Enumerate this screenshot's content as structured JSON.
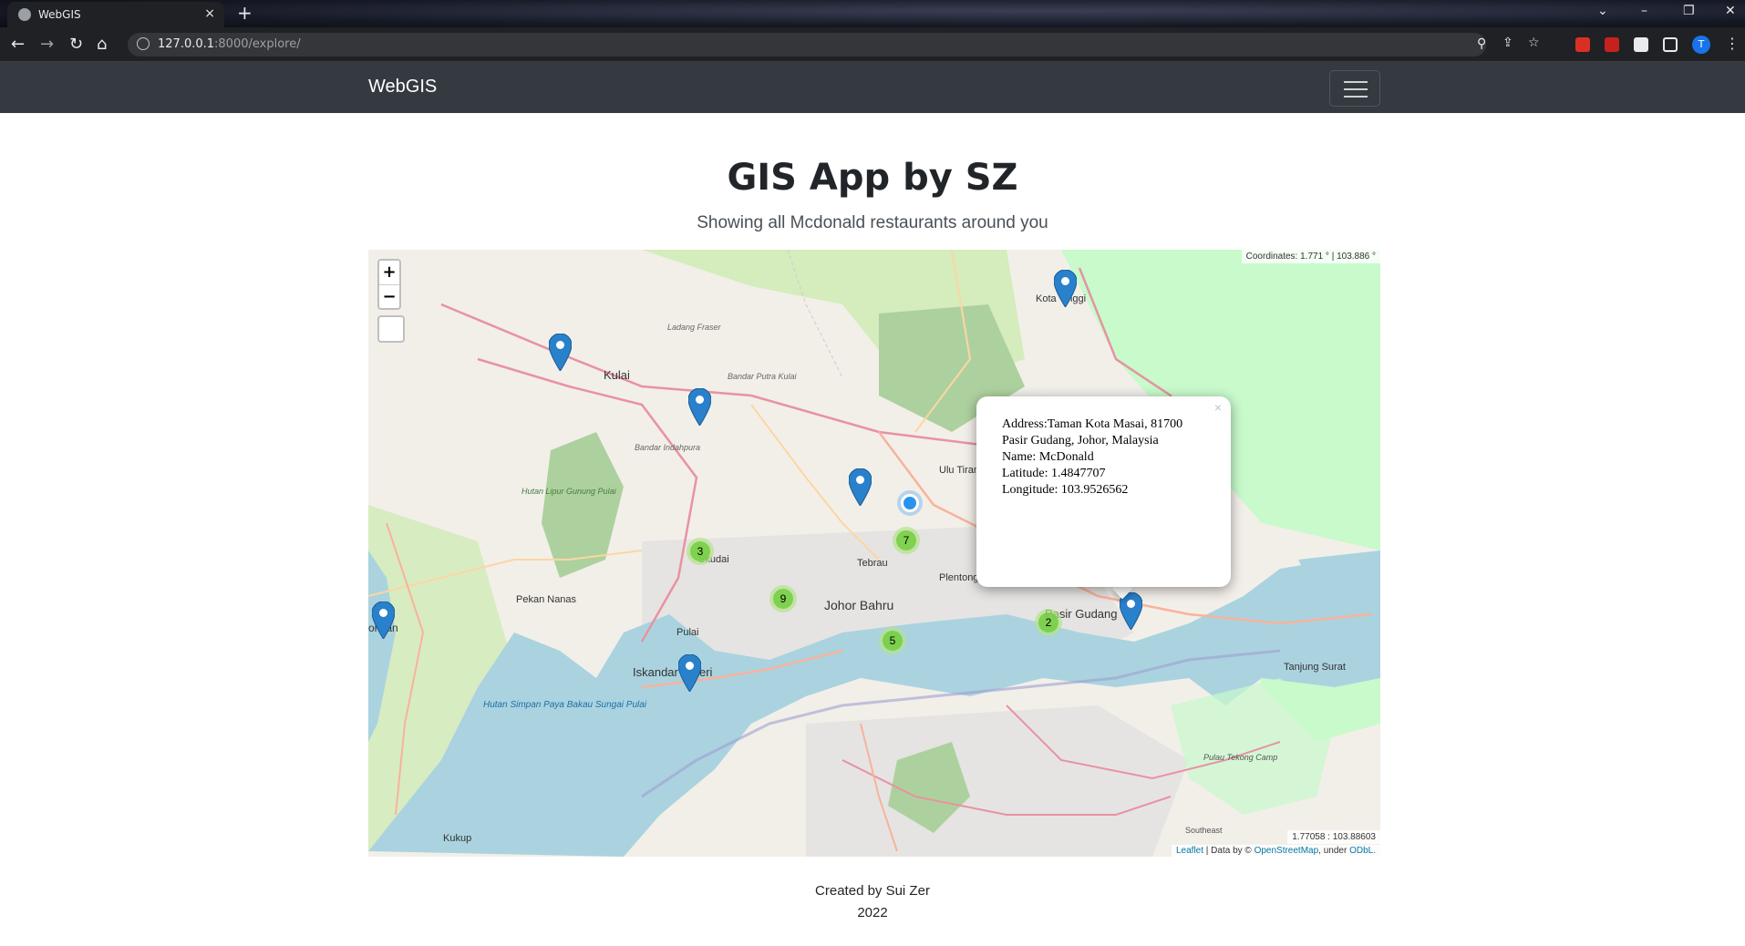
{
  "browser": {
    "tab_title": "WebGIS",
    "tab_close": "×",
    "new_tab": "+",
    "url_host": "127.0.0.1",
    "url_path": ":8000/explore/",
    "profile_initial": "T"
  },
  "navbar": {
    "brand": "WebGIS"
  },
  "header": {
    "title": "GIS App by SZ",
    "subtitle": "Showing all Mcdonald restaurants around you"
  },
  "map": {
    "zoom_in": "+",
    "zoom_out": "−",
    "coordinates": "Coordinates: 1.771 ° | 103.886 °",
    "mouse_position": "1.77058 : 103.88603",
    "attribution": {
      "leaflet": "Leaflet",
      "data_by": " | Data by © ",
      "osm": "OpenStreetMap",
      "under": ", under ",
      "odbl": "ODbL."
    },
    "clusters": [
      "3",
      "7",
      "9",
      "5",
      "2"
    ],
    "place_labels": {
      "kulai": "Kulai",
      "johor_bahru": "Johor Bahru",
      "iskandar_puteri": "Iskandar Puteri",
      "pasir_gudang": "Pasir Gudang",
      "skudai": "Skudai",
      "tebrau": "Tebrau",
      "plentong": "Plentong",
      "kota_tinggi": "Kota Tinggi",
      "ulu_tiram": "Ulu Tiram",
      "pekan_nanas": "Pekan Nanas",
      "tanjung_surat": "Tanjung Surat",
      "kukup": "Kukup",
      "pulai": "Pulai",
      "pontian": "ontian",
      "ladang_fraser": "Ladang Fraser",
      "bandar_putra_kulai": "Bandar Putra Kulai",
      "hutan_lipur": "Hutan Lipur Gunung Pulai",
      "hutan_simpan": "Hutan Simpan Paya Bakau Sungai Pulai",
      "pulau_tekong": "Pulau Tekong Camp",
      "southeast": "Southeast",
      "bandar_indahpura": "Bandar Indahpura"
    },
    "popup": {
      "close": "×",
      "address": "Address:Taman Kota Masai, 81700 Pasir Gudang, Johor, Malaysia",
      "name": "Name: McDonald",
      "latitude": "Latitude: 1.4847707",
      "longitude": "Longitude: 103.9526562"
    }
  },
  "footer": {
    "line1": "Created by Sui Zer",
    "line2": "2022"
  },
  "colors": {
    "navbar_bg": "#343a40",
    "marker_blue": "#2a81cb",
    "cluster_green": "#6ecc39",
    "water": "#aad3df",
    "park": "#c8facc"
  }
}
